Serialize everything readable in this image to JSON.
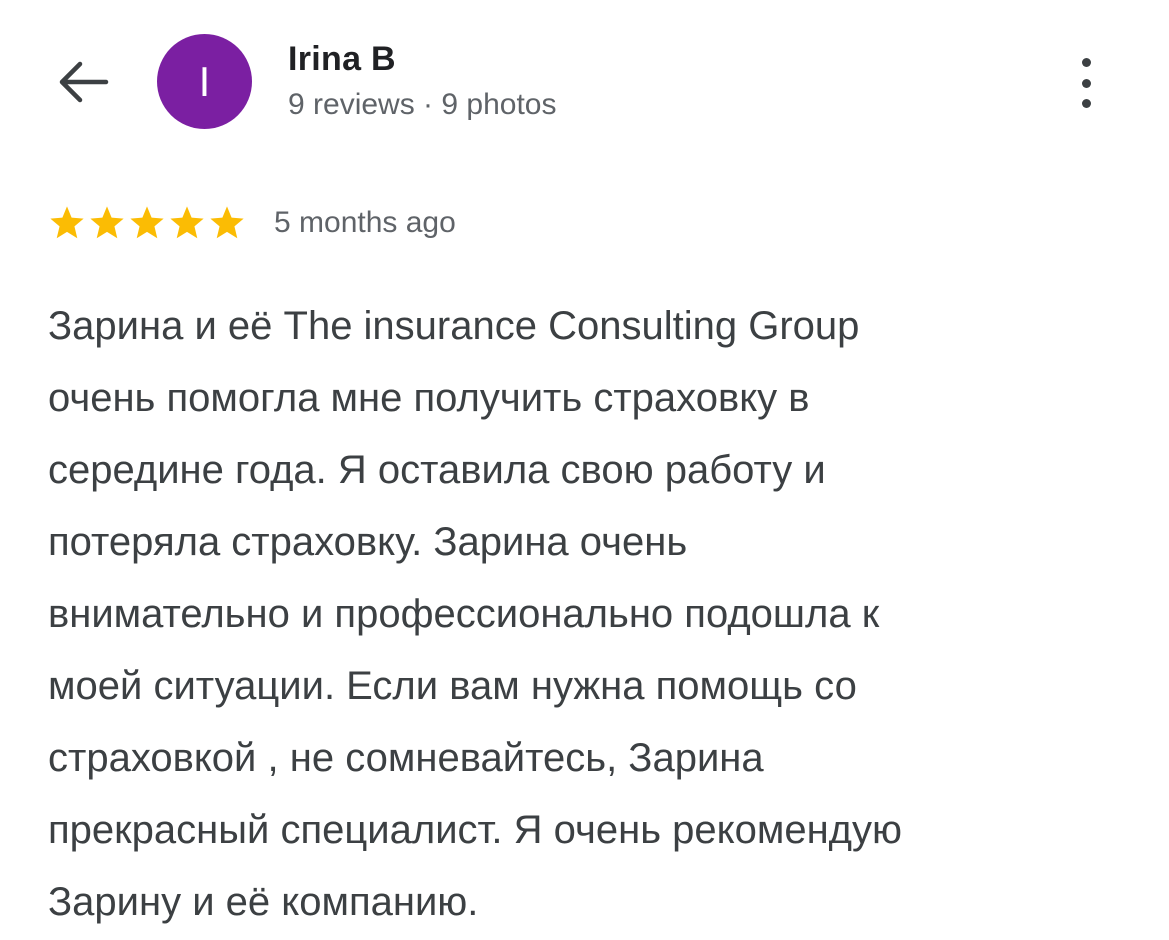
{
  "header": {
    "back_icon": "arrow-left-icon",
    "avatar_letter": "I",
    "avatar_color": "#7b1fa2",
    "reviewer_name": "Irina B",
    "reviewer_meta": "9 reviews · 9 photos",
    "more_icon": "more-vertical-icon"
  },
  "review": {
    "rating": 5,
    "rating_max": 5,
    "star_color": "#fbbc04",
    "time_ago": "5 months ago",
    "text": "Зарина и её The insurance Consulting Group\nочень помогла мне получить страховку в\nсередине года. Я оставила свою работу и\nпотеряла страховку. Зарина очень\nвнимательно и профессионально подошла к\nмоей ситуации. Если вам нужна помощь со\nстраховкой , не сомневайтесь, Зарина\nпрекрасный специалист. Я очень рекомендую\nЗарину и её компанию."
  }
}
